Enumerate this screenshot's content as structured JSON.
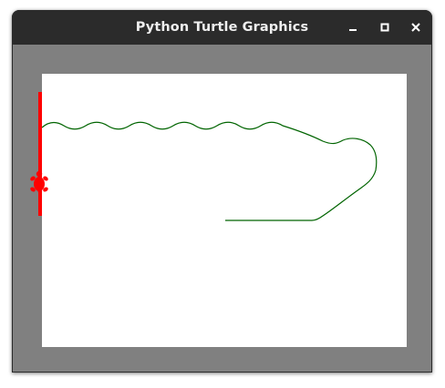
{
  "window": {
    "title": "Python Turtle Graphics"
  },
  "titlebar_buttons": [
    {
      "name": "minimize",
      "icon": "minimize-icon"
    },
    {
      "name": "maximize",
      "icon": "maximize-icon"
    },
    {
      "name": "close",
      "icon": "close-icon"
    }
  ],
  "canvas": {
    "background_color": "#808080",
    "drawing_area_color": "#ffffff"
  },
  "turtle": {
    "shape": "turtle",
    "color": "#ff0000",
    "heading": "up",
    "pen_color": "#ff0000"
  },
  "path": {
    "color": "#006400"
  }
}
